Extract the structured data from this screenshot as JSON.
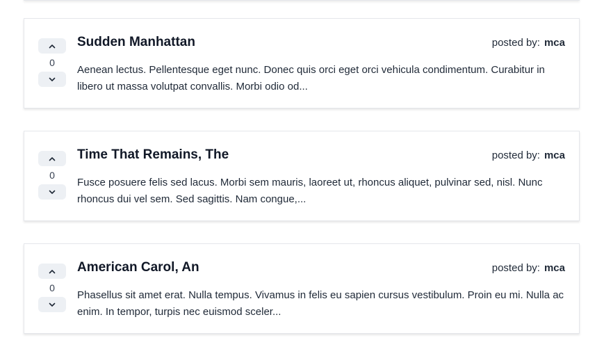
{
  "posts": [
    {
      "title": "Sudden Manhattan",
      "votes": "0",
      "posted_by_label": "posted by:",
      "author": "mca",
      "excerpt": "Aenean lectus. Pellentesque eget nunc. Donec quis orci eget orci vehicula condimentum. Curabitur in libero ut massa volutpat convallis. Morbi odio od..."
    },
    {
      "title": "Time That Remains, The",
      "votes": "0",
      "posted_by_label": "posted by:",
      "author": "mca",
      "excerpt": "Fusce posuere felis sed lacus. Morbi sem mauris, laoreet ut, rhoncus aliquet, pulvinar sed, nisl. Nunc rhoncus dui vel sem. Sed sagittis. Nam congue,..."
    },
    {
      "title": "American Carol, An",
      "votes": "0",
      "posted_by_label": "posted by:",
      "author": "mca",
      "excerpt": "Phasellus sit amet erat. Nulla tempus. Vivamus in felis eu sapien cursus vestibulum. Proin eu mi. Nulla ac enim. In tempor, turpis nec euismod sceler..."
    }
  ],
  "icons": {
    "upvote": "chevron-up-icon",
    "downvote": "chevron-down-icon"
  }
}
